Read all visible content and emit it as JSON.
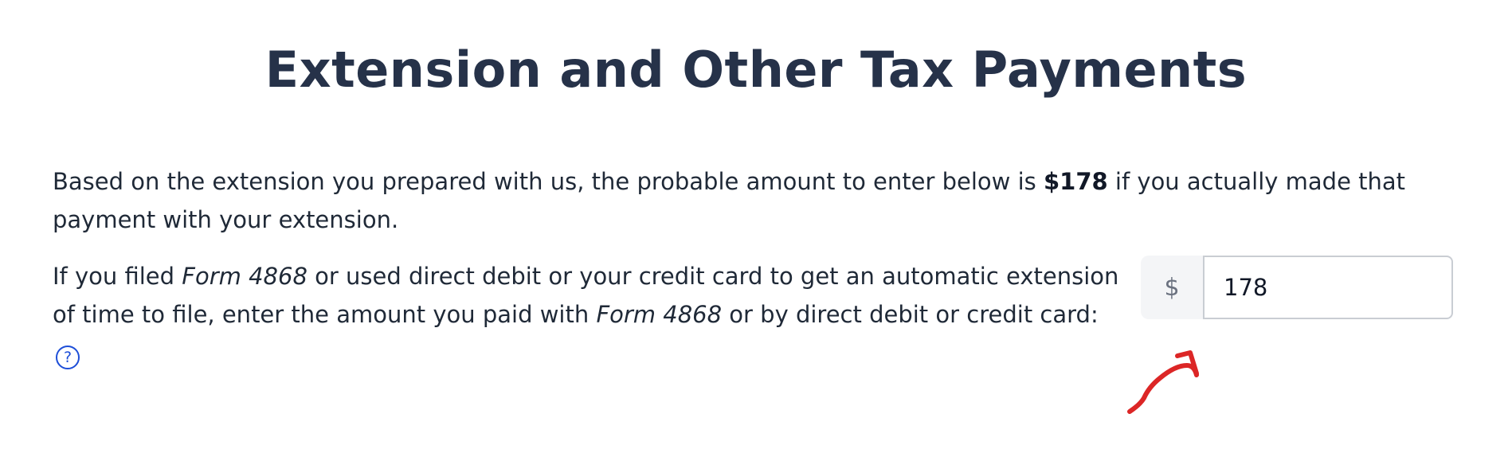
{
  "page": {
    "title": "Extension and Other Tax Payments"
  },
  "intro": {
    "text_before": "Based on the extension you prepared with us, the probable amount to enter below is ",
    "amount": "$178",
    "text_after": " if you actually made that payment with your extension."
  },
  "question": {
    "part1": "If you filed ",
    "form_name_1": "Form 4868",
    "part2": " or used direct debit or your credit card to get an automatic extension of time to file, enter the amount you paid with ",
    "form_name_2": "Form 4868",
    "part3": " or by direct debit or credit card: ",
    "help_icon_glyph": "?"
  },
  "amount_field": {
    "prefix": "$",
    "value": "178"
  },
  "colors": {
    "title": "#263249",
    "text": "#1f2937",
    "help_icon": "#1d4ed8",
    "annotation_arrow": "#dc2626"
  },
  "icons": {
    "help": "help-circle-icon",
    "annotation": "red-arrow-annotation"
  }
}
